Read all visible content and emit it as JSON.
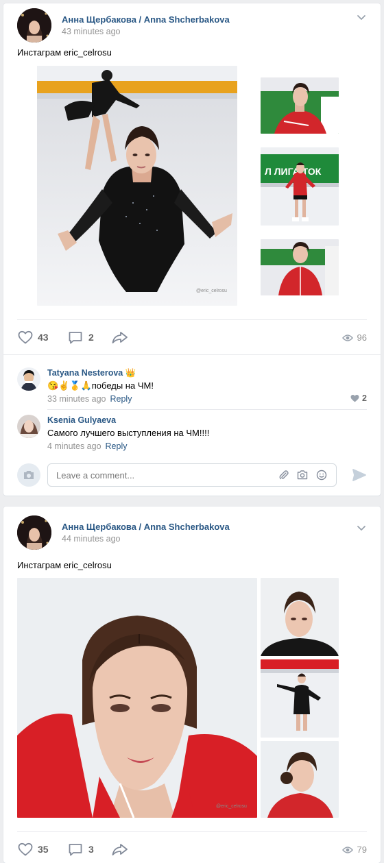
{
  "posts": [
    {
      "author": "Анна Щербакова / Anna Shcherbakova",
      "time": "43 minutes ago",
      "text": "Инстаграм eric_celrosu",
      "likes": "43",
      "comments": "2",
      "views": "96",
      "watermark": "@eric_celrosu"
    },
    {
      "author": "Анна Щербакова / Anna Shcherbakova",
      "time": "44 minutes ago",
      "text": "Инстаграм eric_celrosu",
      "likes": "35",
      "comments": "3",
      "views": "79",
      "watermark": "@eric_celrosu"
    }
  ],
  "comments": [
    {
      "name": "Tatyana Nesterova",
      "badge": "👑",
      "text": "😘✌️🥇🙏победы на ЧМ!",
      "time": "33 minutes ago",
      "reply": "Reply",
      "likes": "2"
    },
    {
      "name": "Ksenia Gulyaeva",
      "text": "Самого лучшего выступления на ЧМ!!!!",
      "time": "4 minutes ago",
      "reply": "Reply"
    }
  ],
  "composer": {
    "placeholder": "Leave a comment..."
  },
  "colors": {
    "link": "#2a5885",
    "muted": "#939393",
    "icon": "#828a99",
    "background": "#edeef0"
  },
  "icons": [
    "chevron-down-icon",
    "heart-icon",
    "comment-icon",
    "share-icon",
    "eye-icon",
    "camera-icon",
    "paperclip-icon",
    "smile-icon",
    "send-icon"
  ]
}
